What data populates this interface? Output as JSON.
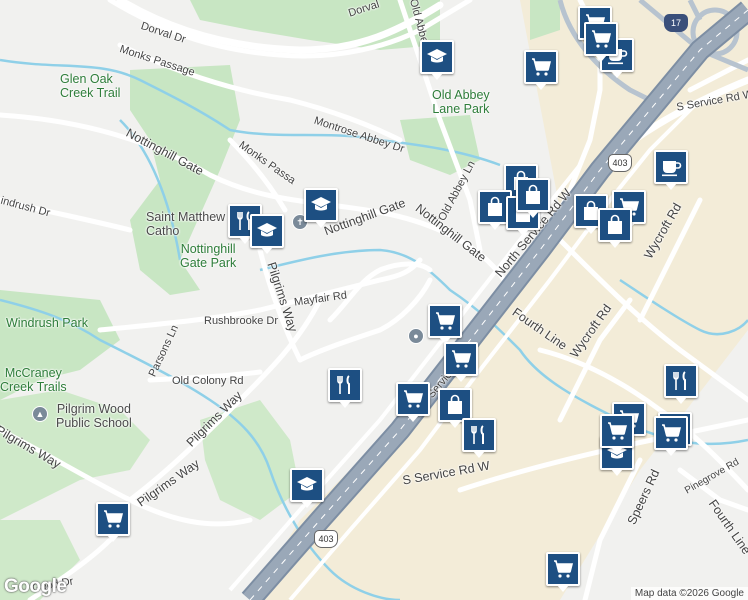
{
  "map": {
    "colors": {
      "land": "#f1f1ef",
      "park": "#c8e6c3",
      "water": "#8fd0e8",
      "highway": "#9aa8b8",
      "highway_edge": "#7d8ea3",
      "commercial": "#f3ecd8",
      "pin": "#1d4f82"
    },
    "roads": {
      "dorval_dr": "Dorval Dr",
      "dorval_top": "Dorval",
      "monks_passage": "Monks Passage",
      "monks_passage_2": "Monks Passa",
      "glen_oak_creek_trail": "Glen Oak Creek Trail",
      "nottinghill_gate_1": "Nottinghill Gate",
      "nottinghill_gate_2": "Nottinghill Gate",
      "nottinghill_gate_3": "Nottinghill Gate",
      "montrose_abbey_dr": "Montrose Abbey Dr",
      "old_abbey_ln": "Old Abbey Ln",
      "old_abbey_top": "Old Abbe",
      "windrush_dr": "indrush Dr",
      "rushbrooke_dr": "Rushbrooke Dr",
      "mayfair_rd": "Mayfair Rd",
      "pilgrims_way_1": "Pilgrims Way",
      "pilgrims_way_2": "Pilgrims Way",
      "pilgrims_way_3": "Pilgrims Way",
      "pilgrims_way_4": "Pilgrims Way",
      "parsons_ln": "Parsons Ln",
      "old_colony_rd": "Old Colony Rd",
      "north_service_rd_w": "North Service Rd W",
      "s_service_rd_w": "S Service Rd W",
      "s_service_rd_w_2": "S Service Rd W",
      "service_rd_w": "Service Rd W",
      "fourth_line_1": "Fourth Line",
      "fourth_line_2": "Fourth Line",
      "wycroft_rd_1": "Wycroft Rd",
      "wycroft_rd_2": "Wycroft Rd",
      "speers_rd": "Speers Rd",
      "pinegrove_rd": "Pinegrove Rd",
      "sway": "s Way",
      "good_dr": "Good Dr"
    },
    "places": {
      "glen_oak": "Glen Oak\nCreek Trail",
      "old_abbey_park": "Old Abbey\nLane Park",
      "st_matthew": "Saint Matthew\nCatho",
      "nottinghill_park": "Nottinghill\nGate Park",
      "windrush_park": "Windrush Park",
      "mccraney": "McCraney\nCreek Trails",
      "pilgrim_wood": "Pilgrim Wood\nPublic School"
    },
    "shields": {
      "hwy_403_a": "403",
      "hwy_403_b": "403",
      "hwy_17": "17"
    },
    "pins": [
      {
        "type": "school",
        "icon": "school-icon"
      },
      {
        "type": "shopping",
        "icon": "cart-icon"
      },
      {
        "type": "shopping",
        "icon": "cart-icon"
      },
      {
        "type": "cafe",
        "icon": "coffee-icon"
      },
      {
        "type": "shopping",
        "icon": "cart-icon"
      },
      {
        "type": "cafe",
        "icon": "coffee-icon"
      },
      {
        "type": "restaurant",
        "icon": "restaurant-icon"
      },
      {
        "type": "school",
        "icon": "school-icon"
      },
      {
        "type": "school",
        "icon": "school-icon"
      },
      {
        "type": "shopping",
        "icon": "bag-icon"
      },
      {
        "type": "shopping",
        "icon": "bag-icon"
      },
      {
        "type": "shopping",
        "icon": "bag-icon"
      },
      {
        "type": "shopping",
        "icon": "bag-icon"
      },
      {
        "type": "shopping",
        "icon": "bag-icon"
      },
      {
        "type": "shopping",
        "icon": "cart-icon"
      },
      {
        "type": "shopping",
        "icon": "bag-icon"
      },
      {
        "type": "shopping",
        "icon": "cart-icon"
      },
      {
        "type": "shopping",
        "icon": "cart-icon"
      },
      {
        "type": "shopping",
        "icon": "cart-icon"
      },
      {
        "type": "shopping",
        "icon": "bag-icon"
      },
      {
        "type": "restaurant",
        "icon": "restaurant-icon"
      },
      {
        "type": "restaurant",
        "icon": "restaurant-icon"
      },
      {
        "type": "school",
        "icon": "school-icon"
      },
      {
        "type": "shopping",
        "icon": "cart-icon"
      },
      {
        "type": "shopping",
        "icon": "cart-icon"
      },
      {
        "type": "restaurant",
        "icon": "restaurant-icon"
      },
      {
        "type": "shopping",
        "icon": "cart-icon"
      },
      {
        "type": "school",
        "icon": "school-icon"
      },
      {
        "type": "shopping",
        "icon": "cart-icon"
      },
      {
        "type": "shopping",
        "icon": "cart-icon"
      },
      {
        "type": "shopping",
        "icon": "cart-icon"
      }
    ],
    "attribution": "Map data ©2026 Google",
    "logo": "Google"
  }
}
